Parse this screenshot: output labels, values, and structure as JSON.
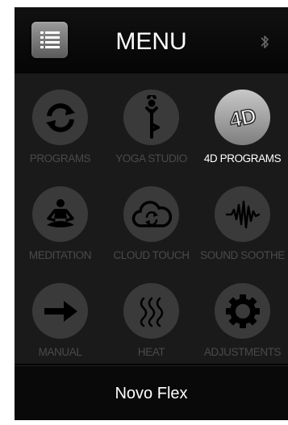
{
  "header": {
    "title": "MENU",
    "left_icon": "list-menu-icon",
    "right_icon": "bluetooth-icon"
  },
  "menu": {
    "items": [
      {
        "label": "PROGRAMS",
        "icon": "refresh-icon",
        "active": false
      },
      {
        "label": "YOGA STUDIO",
        "icon": "yoga-pose-icon",
        "active": false
      },
      {
        "label": "4D PROGRAMS",
        "icon": "4d-icon",
        "icon_text": "4D",
        "active": true
      },
      {
        "label": "MEDITATION",
        "icon": "meditation-icon",
        "active": false
      },
      {
        "label": "CLOUD TOUCH",
        "icon": "cloud-sync-icon",
        "active": false
      },
      {
        "label": "SOUND SOOTHE",
        "icon": "sound-wave-icon",
        "active": false
      },
      {
        "label": "MANUAL",
        "icon": "arrow-right-icon",
        "active": false
      },
      {
        "label": "HEAT",
        "icon": "heat-waves-icon",
        "active": false
      },
      {
        "label": "ADJUSTMENTS",
        "icon": "gear-icon",
        "active": false
      }
    ]
  },
  "footer": {
    "device_name": "Novo Flex"
  },
  "colors": {
    "background": "#000000",
    "grid_background": "#1a1a1a",
    "inactive_circle": "#3a3a3a",
    "inactive_icon": "#000000",
    "inactive_label": "#4a4a4a",
    "active_label": "#ffffff"
  }
}
